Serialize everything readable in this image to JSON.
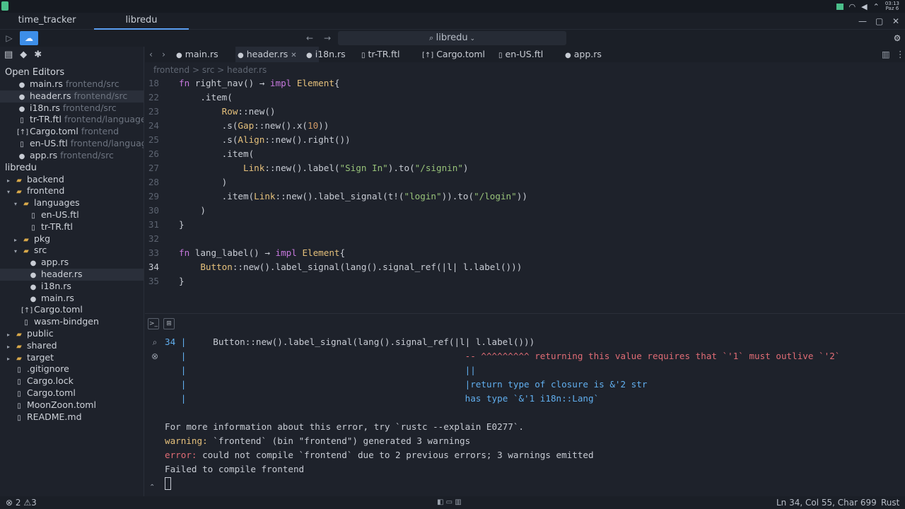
{
  "workspace_tabs": [
    "time_tracker",
    "libredu"
  ],
  "search": {
    "label": "libredu"
  },
  "sidebar": {
    "open_editors_title": "Open Editors",
    "open_editors": [
      {
        "name": "main.rs",
        "path": "frontend/src"
      },
      {
        "name": "header.rs",
        "path": "frontend/src"
      },
      {
        "name": "i18n.rs",
        "path": "frontend/src"
      },
      {
        "name": "tr-TR.ftl",
        "path": "frontend/languages"
      },
      {
        "name": "Cargo.toml",
        "path": "frontend"
      },
      {
        "name": "en-US.ftl",
        "path": "frontend/language"
      },
      {
        "name": "app.rs",
        "path": "frontend/src"
      }
    ],
    "project_title": "libredu",
    "tree": [
      {
        "name": "backend",
        "depth": 0,
        "kind": "folder",
        "open": false
      },
      {
        "name": "frontend",
        "depth": 0,
        "kind": "folder",
        "open": true
      },
      {
        "name": "languages",
        "depth": 1,
        "kind": "folder",
        "open": true
      },
      {
        "name": "en-US.ftl",
        "depth": 2,
        "kind": "file"
      },
      {
        "name": "tr-TR.ftl",
        "depth": 2,
        "kind": "file"
      },
      {
        "name": "pkg",
        "depth": 1,
        "kind": "folder",
        "open": false
      },
      {
        "name": "src",
        "depth": 1,
        "kind": "folder",
        "open": true
      },
      {
        "name": "app.rs",
        "depth": 2,
        "kind": "rust"
      },
      {
        "name": "header.rs",
        "depth": 2,
        "kind": "rust"
      },
      {
        "name": "i18n.rs",
        "depth": 2,
        "kind": "rust"
      },
      {
        "name": "main.rs",
        "depth": 2,
        "kind": "rust"
      },
      {
        "name": "Cargo.toml",
        "depth": 1,
        "kind": "toml"
      },
      {
        "name": "wasm-bindgen",
        "depth": 1,
        "kind": "file"
      },
      {
        "name": "public",
        "depth": 0,
        "kind": "folder",
        "open": false
      },
      {
        "name": "shared",
        "depth": 0,
        "kind": "folder",
        "open": false
      },
      {
        "name": "target",
        "depth": 0,
        "kind": "folder",
        "open": false
      },
      {
        "name": ".gitignore",
        "depth": 0,
        "kind": "file"
      },
      {
        "name": "Cargo.lock",
        "depth": 0,
        "kind": "file"
      },
      {
        "name": "Cargo.toml",
        "depth": 0,
        "kind": "file"
      },
      {
        "name": "MoonZoon.toml",
        "depth": 0,
        "kind": "file"
      },
      {
        "name": "README.md",
        "depth": 0,
        "kind": "file"
      }
    ]
  },
  "editor_tabs": [
    "main.rs",
    "header.rs",
    "i18n.rs",
    "tr-TR.ftl",
    "Cargo.toml",
    "en-US.ftl",
    "app.rs"
  ],
  "breadcrumb": "frontend > src > header.rs",
  "code_lines": [
    {
      "n": "18",
      "src": "fn right_nav() → impl Element{"
    },
    {
      "n": "22",
      "src": "    .item("
    },
    {
      "n": "23",
      "src": "        Row::new()"
    },
    {
      "n": "24",
      "src": "        .s(Gap::new().x(10))"
    },
    {
      "n": "25",
      "src": "        .s(Align::new().right())"
    },
    {
      "n": "26",
      "src": "        .item("
    },
    {
      "n": "27",
      "src": "            Link::new().label(\"Sign In\").to(\"/signin\")"
    },
    {
      "n": "28",
      "src": "        )"
    },
    {
      "n": "29",
      "src": "        .item(Link::new().label_signal(t!(\"login\")).to(\"/login\"))"
    },
    {
      "n": "30",
      "src": "    )"
    },
    {
      "n": "31",
      "src": "}"
    },
    {
      "n": "32",
      "src": ""
    },
    {
      "n": "33",
      "src": "fn lang_label() → impl Element{"
    },
    {
      "n": "34",
      "src": "    Button::new().label_signal(lang().signal_ref(|l| l.label()))"
    },
    {
      "n": "35",
      "src": "}"
    }
  ],
  "terminal_lines": [
    "34 |     Button::new().label_signal(lang().signal_ref(|l| l.label()))",
    "   |                                                    -- ^^^^^^^^^ returning this value requires that `'1` must outlive `'2`",
    "   |                                                    ||",
    "   |                                                    |return type of closure is &'2 str",
    "   |                                                    has type `&'1 i18n::Lang`",
    "",
    "For more information about this error, try `rustc --explain E0277`.",
    "warning: `frontend` (bin \"frontend\") generated 3 warnings",
    "error: could not compile `frontend` due to 2 previous errors; 3 warnings emitted",
    "Failed to compile frontend"
  ],
  "status": {
    "errors": "2",
    "warnings": "3",
    "position": "Ln 34, Col 55, Char 699",
    "language": "Rust"
  },
  "clock": {
    "time": "03:13",
    "day": "Paz 6"
  }
}
